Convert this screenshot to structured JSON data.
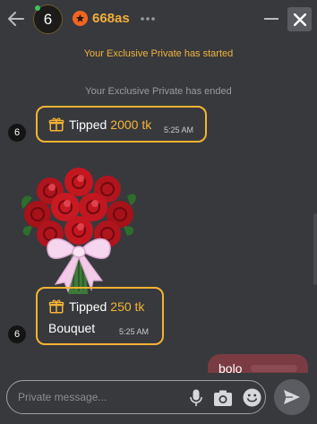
{
  "header": {
    "avatar_initial": "6",
    "username": "668as",
    "online_color": "#3ec25f",
    "badge_color": "#f26522",
    "icons": {
      "back": "arrow-left-icon",
      "badge": "star-icon",
      "more": "more-horizontal-icon",
      "minimize": "minimize-icon",
      "close": "close-icon"
    }
  },
  "messages": {
    "system_started": "Your Exclusive Private has started",
    "system_ended": "Your Exclusive Private has ended",
    "tip1": {
      "sender_initial": "6",
      "label": "Tipped",
      "amount": "2000 tk",
      "time": "5:25 AM"
    },
    "tip2": {
      "sender_initial": "6",
      "label": "Tipped",
      "amount": "250 tk",
      "gift_name": "Bouquet",
      "time": "5:25 AM"
    },
    "outgoing": {
      "text": "bolo"
    }
  },
  "composer": {
    "placeholder": "Private message...",
    "value": "",
    "icons": {
      "mic": "microphone-icon",
      "camera": "camera-icon",
      "emoji": "emoji-icon",
      "send": "send-icon"
    }
  },
  "colors": {
    "background": "#38393d",
    "accent_gold": "#f5b432",
    "username_color": "#f2ad3c",
    "outgoing_bubble": "#7a3b42"
  }
}
